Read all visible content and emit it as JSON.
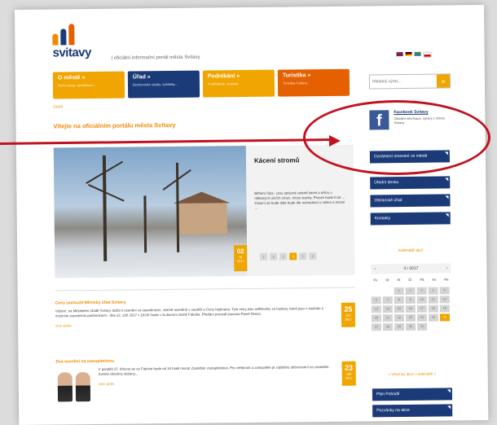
{
  "logo": {
    "text": "svitavy"
  },
  "tagline": "| oficiální informační portál města Svitavy",
  "nav": [
    {
      "label": "O městě »",
      "sub": "Profil města, Identifikace...",
      "color": "#f0a500"
    },
    {
      "label": "Úřad »",
      "sub": "Elektronické služby, Vyhlášky...",
      "color": "#1b3a78"
    },
    {
      "label": "Podnikání »",
      "sub": "Podnikatelé, projekty...",
      "color": "#f0a500"
    },
    {
      "label": "Turistika »",
      "sub": "Turistika, Kultura...",
      "color": "#e56000"
    }
  ],
  "search": {
    "placeholder": "Hledaný výraz...",
    "button": "»"
  },
  "breadcrumb": "Úvod",
  "page_title": "Vítejte na oficiálním portálu města Svitavy",
  "hero": {
    "title": "Kácení stromů",
    "text": "Během října - jsou správné zeleně kácet a ořezy v některých ulicích ztrací, místo stavby. Proces bude trvat ... Kácení se bude dále bude dle rozhodnutí o zeleni a místní ...",
    "date_day": "02",
    "date_month": "říj",
    "date_year": "2017",
    "pager": [
      "1",
      "2",
      "3",
      "4",
      "5",
      "6"
    ]
  },
  "articles": [
    {
      "title": "Ceny zasloužil Městský úřad Svitavy",
      "text": "Vážení, na Městském úřadě Svitavy došlo k ocenění ve stavebnictví, včetně oceněné v soutěži o Ceny hejtmana. Tyto ceny jsou udělovány za budovy, které jsou v souladu s místními stavebními podmínkami - dne 22. září 2017 v 18:00 hodin v Kulturním domě Fabrika. Předání provedl starosta Pavel Šimon.",
      "more": "více zpráv",
      "date_day": "25",
      "date_month": "září",
      "date_year": "2017"
    },
    {
      "title": "Dva ocenění na zastupitelstvu",
      "text": "V pondělí 27. března se ve Fabrice bude od 16 hodin konat Zasedání zastupitelstva. Pro veřejnost a zastupitele je zajištěno občerstvení na zasedání. Zveme všechny občany...",
      "more": "více zpráv",
      "date_day": "23",
      "date_month": "září",
      "date_year": "2017"
    }
  ],
  "facebook": {
    "title": "Facebook Svitavy",
    "desc": "Oficiální informace, zprávy z města Svitavy"
  },
  "sidebar_buttons": [
    "Oznámení omezení ve městě",
    "Úřední deska",
    "Občanské úřad",
    "Kontakty"
  ],
  "calendar": {
    "title": "Kalendář akcí",
    "month": "3 / 2017",
    "prev": "‹",
    "next": "›",
    "days": [
      "Po",
      "Út",
      "St",
      "Čt",
      "Pá",
      "So",
      "Ne"
    ],
    "highlight": "26"
  },
  "more_events": "» Všechny akce v kalendáři »",
  "bottom_buttons": [
    "Plán Pohodlí",
    "Pozvánky na akce"
  ],
  "colors": {
    "orange": "#f0a500",
    "navy": "#1b3a78",
    "annotation": "#c1121f"
  }
}
